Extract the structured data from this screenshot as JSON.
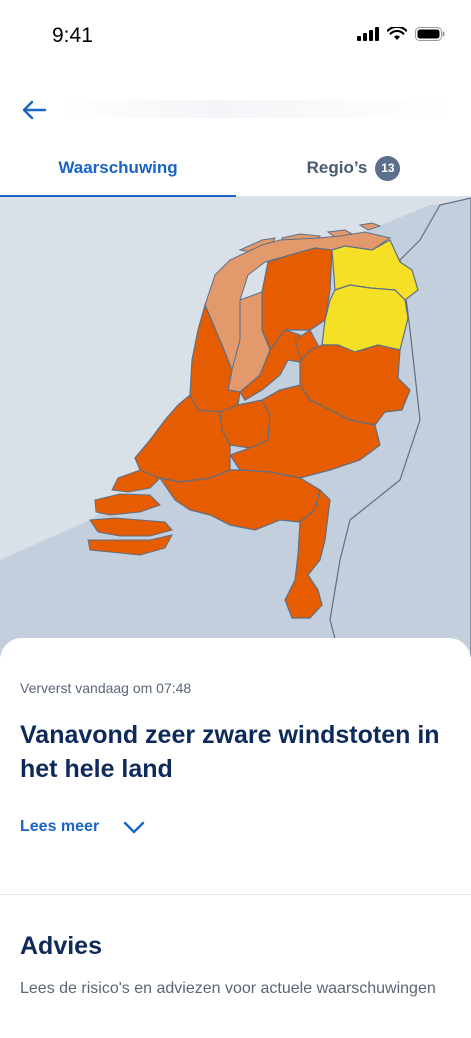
{
  "status_bar": {
    "time": "9:41"
  },
  "nav": {
    "back_icon": "arrow-left-icon"
  },
  "tabs": {
    "warning_label": "Waarschuwing",
    "regions_label": "Regio’s",
    "regions_count": "13"
  },
  "map": {
    "colors": {
      "water": "#c3cfdc",
      "orange": "#e65c00",
      "light_orange": "#e29a6c",
      "yellow": "#f6e025",
      "border": "#5e6f86"
    },
    "regions": [
      {
        "name": "Noord-Holland",
        "level": "orange"
      },
      {
        "name": "Friesland",
        "level": "orange"
      },
      {
        "name": "Groningen",
        "level": "yellow"
      },
      {
        "name": "Drenthe",
        "level": "yellow"
      },
      {
        "name": "Waddeneilanden",
        "level": "light_orange"
      },
      {
        "name": "IJsselmeergebied",
        "level": "light_orange"
      },
      {
        "name": "Flevoland",
        "level": "orange"
      },
      {
        "name": "Overijssel",
        "level": "orange"
      },
      {
        "name": "Gelderland",
        "level": "orange"
      },
      {
        "name": "Utrecht",
        "level": "orange"
      },
      {
        "name": "Zuid-Holland",
        "level": "orange"
      },
      {
        "name": "Zeeland",
        "level": "orange"
      },
      {
        "name": "Noord-Brabant",
        "level": "orange"
      },
      {
        "name": "Limburg",
        "level": "orange"
      }
    ]
  },
  "detail": {
    "refreshed": "Ververst vandaag om 07:48",
    "headline": "Vanavond zeer zware windstoten in het hele land",
    "read_more": "Lees meer"
  },
  "advice": {
    "title": "Advies",
    "text": "Lees de risico's en adviezen voor actuele waarschuwingen"
  },
  "theme": {
    "accent": "#1a63c7",
    "heading": "#0d2a5a"
  }
}
